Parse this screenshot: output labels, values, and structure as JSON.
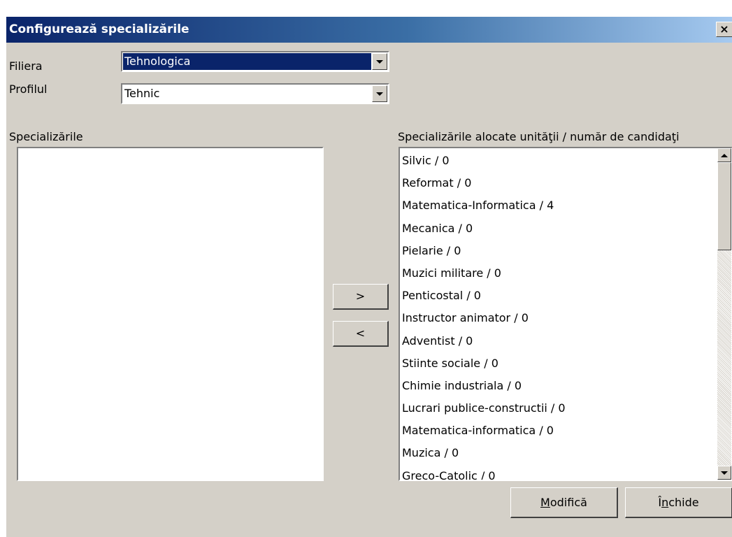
{
  "window": {
    "title": "Configurează specializările",
    "close_label": "×"
  },
  "form": {
    "filiera_label": "Filiera",
    "filiera_value": "Tehnologica",
    "profil_label": "Profilul",
    "profil_value": "Tehnic"
  },
  "available": {
    "label": "Specializările",
    "items": []
  },
  "allocated": {
    "label": "Specializările alocate unităţii / număr de candidaţi",
    "items": [
      "Silvic / 0",
      "Reformat / 0",
      "Matematica-Informatica / 4",
      "Mecanica / 0",
      "Pielarie / 0",
      "Muzici militare / 0",
      "Penticostal / 0",
      "Instructor animator / 0",
      "Adventist / 0",
      "Stiinte sociale / 0",
      "Chimie industriala / 0",
      "Lucrari publice-constructii / 0",
      "Matematica-informatica / 0",
      "Muzica / 0",
      "Greco-Catolic / 0"
    ]
  },
  "buttons": {
    "add": ">",
    "remove": "<",
    "modify_mnemonic": "M",
    "modify_rest": "odifică",
    "close_prefix": "Î",
    "close_mnemonic": "n",
    "close_rest": "chide"
  }
}
